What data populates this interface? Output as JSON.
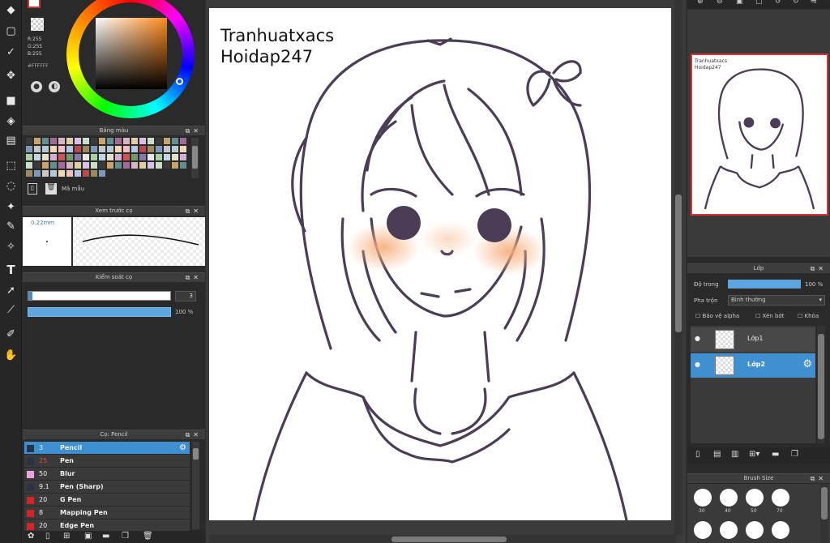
{
  "color_picker": {
    "r": "R:255",
    "g": "G:255",
    "b": "B:255",
    "hex": "#FFFFFF"
  },
  "palette_panel": {
    "title": "Bảng màu",
    "template_label": "Mã mẫu"
  },
  "brush_preview_panel": {
    "title": "Xem trước cọ",
    "size": "0.22mm"
  },
  "brush_control_panel": {
    "title": "Kiểm soát cọ",
    "size_value": "3",
    "opacity_value": "100 %"
  },
  "brush_panel": {
    "title": "Cọ: Pencil",
    "items": [
      {
        "size": "3",
        "name": "Pencil",
        "color": "#2a3344",
        "selected": true
      },
      {
        "size": "25",
        "name": "Pen",
        "color": "#2a3344",
        "selected": false
      },
      {
        "size": "50",
        "name": "Blur",
        "color": "#f0a0e0",
        "selected": false
      },
      {
        "size": "9.1",
        "name": "Pen (Sharp)",
        "color": "#2a3344",
        "selected": false
      },
      {
        "size": "20",
        "name": "G Pen",
        "color": "#e02020",
        "selected": false
      },
      {
        "size": "8",
        "name": "Mapping Pen",
        "color": "#e02020",
        "selected": false
      },
      {
        "size": "20",
        "name": "Edge Pen",
        "color": "#e02020",
        "selected": false
      }
    ]
  },
  "canvas": {
    "line1": "Tranhuatxacs",
    "line2": "Hoidap247"
  },
  "navigator": {
    "thumb_text": "Tranhuatxacs Hoidap247"
  },
  "layer_panel": {
    "title": "Lớp",
    "opacity_label": "Độ trong",
    "opacity_value": "100 %",
    "blend_label": "Pha trộn",
    "blend_value": "Bình thường",
    "protect_alpha": "Bảo vệ alpha",
    "clipping": "Xén bớt",
    "lock": "Khóa",
    "layers": [
      {
        "name": "Lớp1",
        "selected": false
      },
      {
        "name": "Lớp2",
        "selected": true
      }
    ]
  },
  "brush_size_panel": {
    "title": "Brush Size",
    "sizes": [
      "30",
      "40",
      "50",
      "70"
    ]
  }
}
